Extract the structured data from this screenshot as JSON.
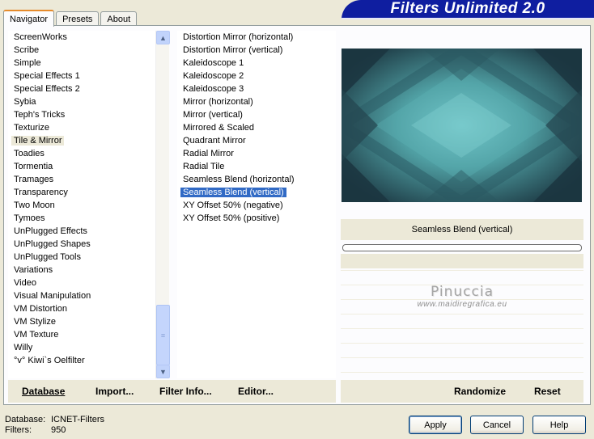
{
  "title": "Filters Unlimited 2.0",
  "tabs": [
    "Navigator",
    "Presets",
    "About"
  ],
  "categories": [
    "ScreenWorks",
    "Scribe",
    "Simple",
    "Special Effects 1",
    "Special Effects 2",
    "Sybia",
    "Teph's Tricks",
    "Texturize",
    "Tile & Mirror",
    "Toadies",
    "Tormentia",
    "Tramages",
    "Transparency",
    "Two Moon",
    "Tymoes",
    "UnPlugged Effects",
    "UnPlugged Shapes",
    "UnPlugged Tools",
    "Variations",
    "Video",
    "Visual Manipulation",
    "VM Distortion",
    "VM Stylize",
    "VM Texture",
    "Willy",
    "°v° Kiwi`s Oelfilter"
  ],
  "selected_category": "Tile & Mirror",
  "filters": [
    "Distortion Mirror (horizontal)",
    "Distortion Mirror (vertical)",
    "Kaleidoscope 1",
    "Kaleidoscope 2",
    "Kaleidoscope 3",
    "Mirror (horizontal)",
    "Mirror (vertical)",
    "Mirrored & Scaled",
    "Quadrant Mirror",
    "Radial Mirror",
    "Radial Tile",
    "Seamless Blend (horizontal)",
    "Seamless Blend (vertical)",
    "XY Offset 50% (negative)",
    "XY Offset 50% (positive)"
  ],
  "selected_filter": "Seamless Blend (vertical)",
  "current_filter_name": "Seamless Blend (vertical)",
  "buttons": {
    "database": "Database",
    "import": "Import...",
    "filter_info": "Filter Info...",
    "editor": "Editor...",
    "randomize": "Randomize",
    "reset": "Reset",
    "apply": "Apply",
    "cancel": "Cancel",
    "help": "Help"
  },
  "watermark": {
    "name": "Pinuccia",
    "url": "www.maidiregrafica.eu"
  },
  "status": {
    "database_label": "Database:",
    "database_value": "ICNET-Filters",
    "filters_label": "Filters:",
    "filters_value": "950"
  },
  "colors": {
    "title_bg": "#0f1ea0",
    "selection": "#316ac5",
    "preview_teal": "#3c8a90"
  }
}
